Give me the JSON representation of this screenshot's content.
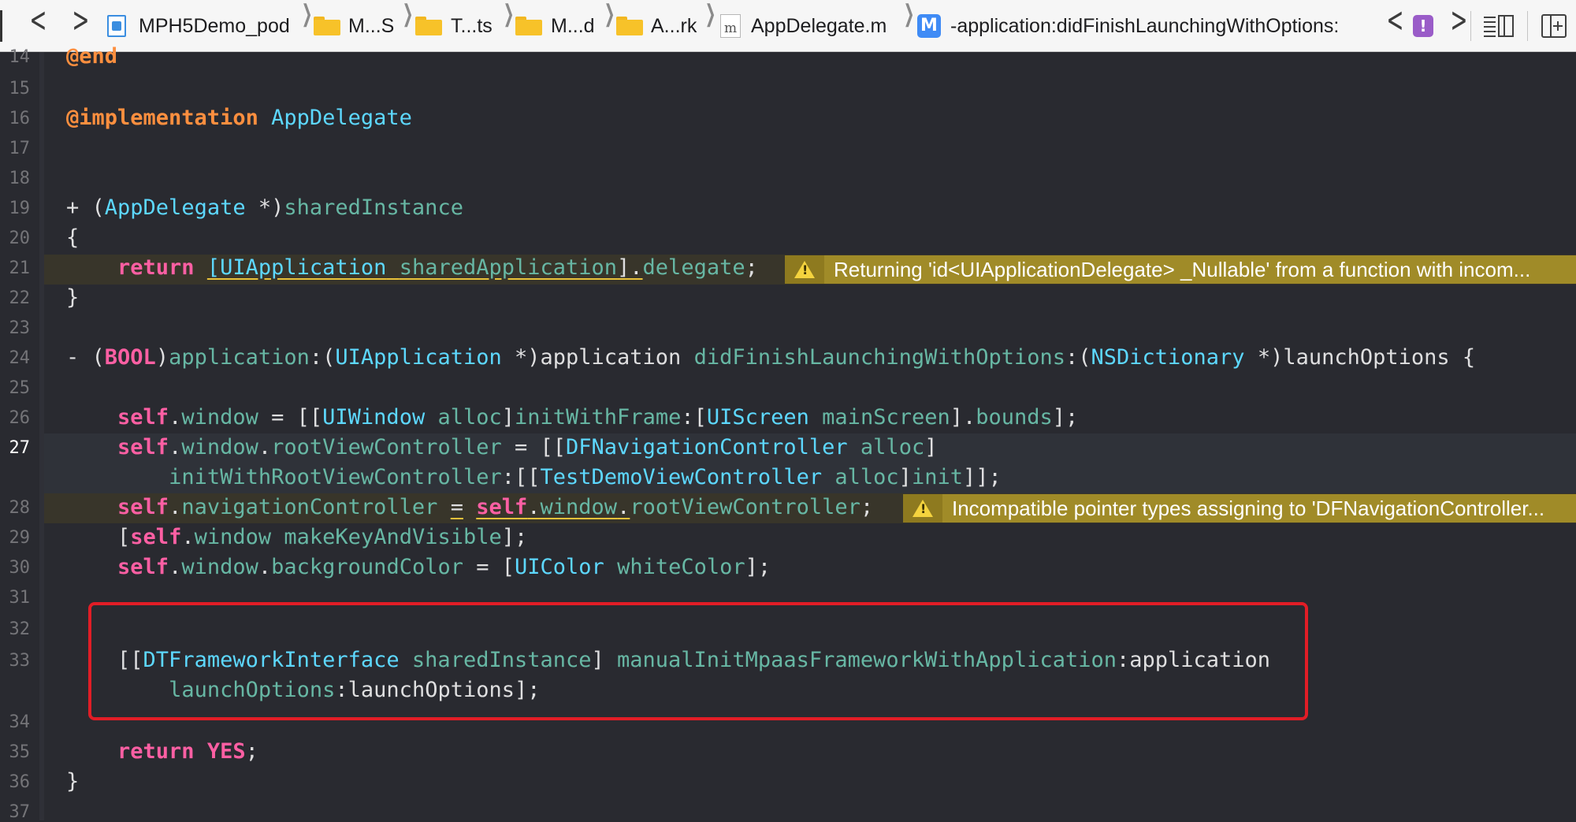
{
  "jumpbar": {
    "nav_back": "<",
    "nav_forward": ">",
    "breadcrumbs": [
      "MPH5Demo_pod",
      "M...S",
      "T...ts",
      "M...d",
      "A...rk",
      "AppDelegate.m",
      "-application:didFinishLaunchingWithOptions:"
    ],
    "file_icon_letter": "m",
    "method_badge": "M",
    "issue_prev": "<",
    "issue_badge": "!",
    "issue_next": ">"
  },
  "editor": {
    "line_numbers": [
      "14",
      "15",
      "16",
      "17",
      "18",
      "19",
      "20",
      "21",
      "22",
      "23",
      "24",
      "25",
      "26",
      "27",
      "",
      "28",
      "29",
      "30",
      "31",
      "32",
      "33",
      "",
      "34",
      "35",
      "36",
      "37"
    ],
    "current_line": "27",
    "warnings": [
      "Returning 'id<UIApplicationDelegate> _Nullable' from a function with incom...",
      "Incompatible pointer types assigning to 'DFNavigationController..."
    ]
  },
  "colors": {
    "background": "#292a30",
    "keyword": "#fc5fa3",
    "type": "#5dd8ff",
    "method": "#67b7a4",
    "warning": "#a08b28",
    "highlight_box": "#e11d26"
  }
}
